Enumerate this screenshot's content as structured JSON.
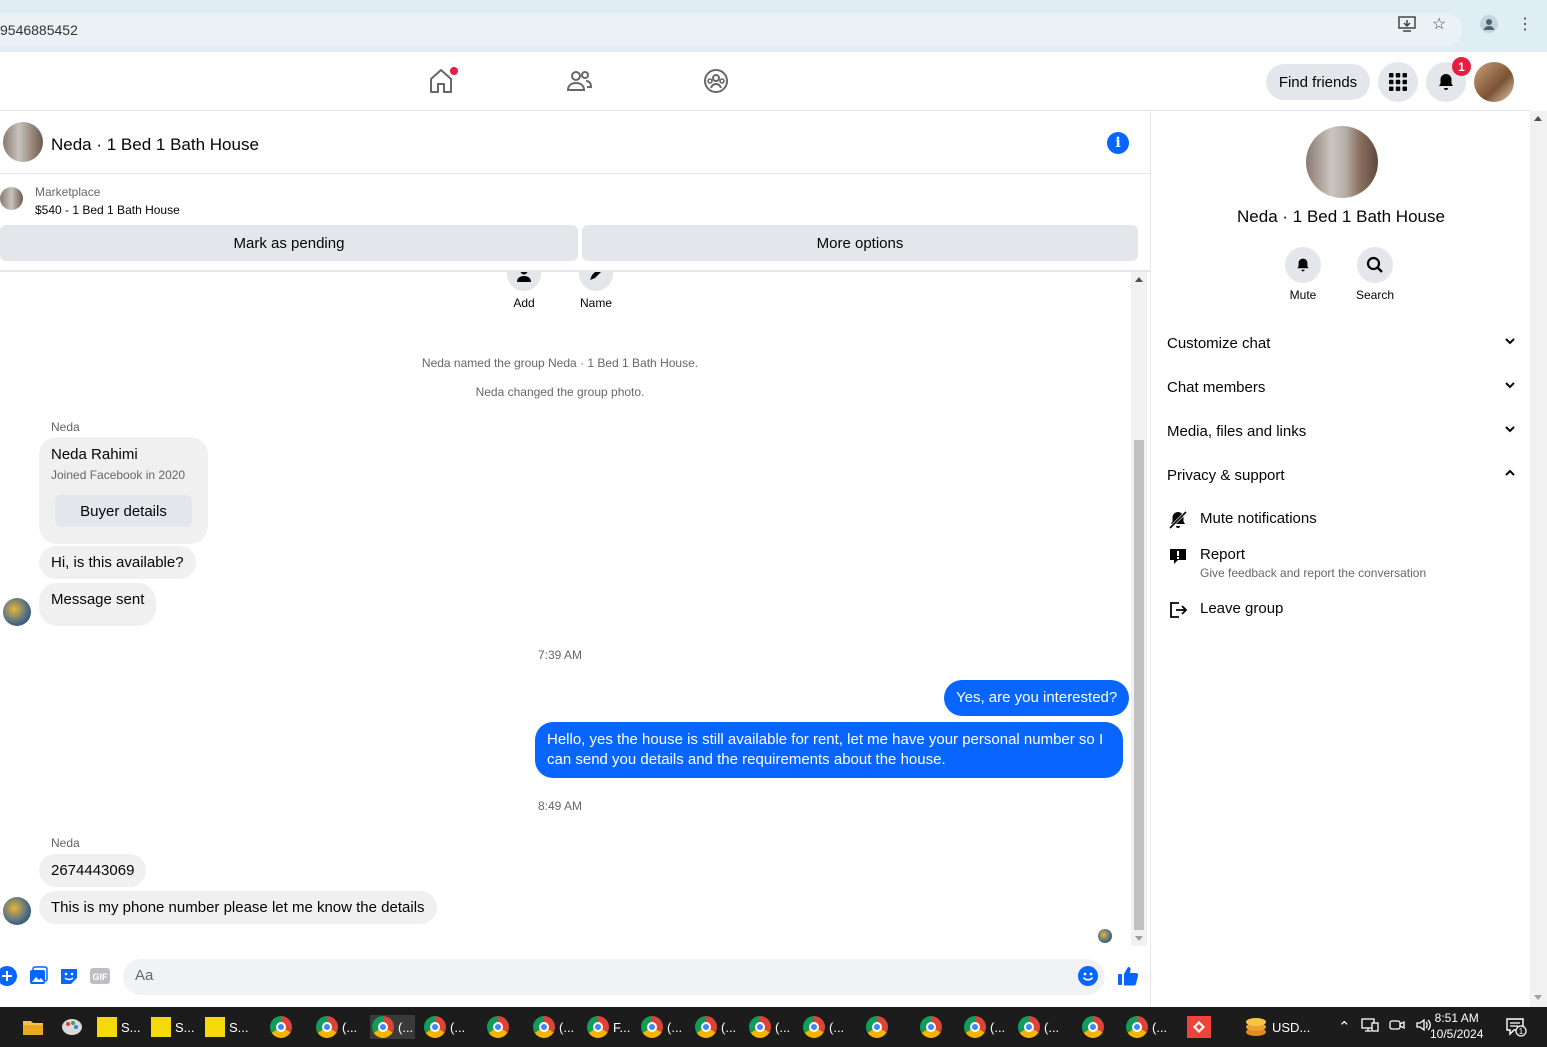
{
  "browser": {
    "url": "9546885452"
  },
  "nav": {
    "find_friends": "Find friends",
    "notification_count": "1"
  },
  "chat": {
    "title": "Neda · 1 Bed 1 Bath House",
    "marketplace_label": "Marketplace",
    "listing": "$540 - 1 Bed 1 Bath House",
    "mark_pending": "Mark as pending",
    "more_options": "More options",
    "add_label": "Add",
    "name_label": "Name",
    "sys_named": "Neda named the group Neda · 1 Bed 1 Bath House.",
    "sys_photo": "Neda changed the group photo.",
    "sender1": "Neda",
    "card_name": "Neda Rahimi",
    "card_joined": "Joined Facebook in 2020",
    "buyer_details": "Buyer details",
    "msg1": "Hi, is this available?",
    "msg2": "Message sent",
    "time1": "7:39 AM",
    "out1": "Yes, are you interested?",
    "out2": "Hello, yes the house is still available for rent, let me have your personal number so I can send you details and the requirements about the house.",
    "time2": "8:49 AM",
    "sender2": "Neda",
    "msg3": "2674443069",
    "msg4": "This is my phone number please let me know the details",
    "composer_placeholder": "Aa"
  },
  "panel": {
    "title": "Neda · 1 Bed 1 Bath House",
    "mute": "Mute",
    "search": "Search",
    "customize": "Customize chat",
    "members": "Chat members",
    "media": "Media, files and links",
    "privacy": "Privacy & support",
    "mute_notifications": "Mute notifications",
    "report": "Report",
    "report_desc": "Give feedback and report the conversation",
    "leave": "Leave group"
  },
  "taskbar": {
    "items": [
      "S...",
      "S...",
      "S...",
      "(...",
      "(...",
      "(...",
      "(...",
      "F...",
      "(...",
      "(...",
      "(...",
      "(...",
      "(...",
      "(...",
      "(...",
      "(..."
    ],
    "currency": "USD...",
    "time": "8:51 AM",
    "date": "10/5/2024",
    "notif": "1"
  },
  "colors": {
    "accent": "#0866ff",
    "badge": "#e41e3f"
  }
}
